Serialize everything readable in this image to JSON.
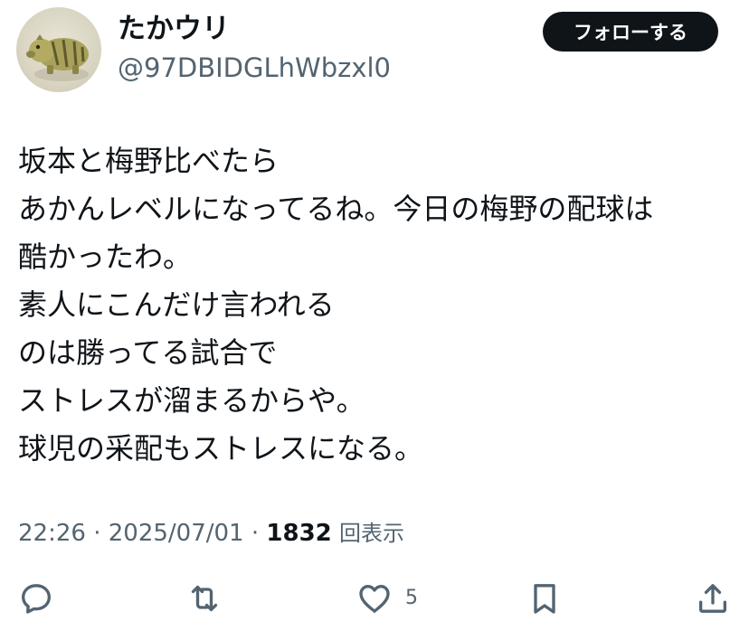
{
  "user": {
    "display_name": "たかウリ",
    "handle": "@97DBIDGLhWbzxl0"
  },
  "follow_button": {
    "label": "フォローする"
  },
  "tweet": {
    "lines": [
      "坂本と梅野比べたら",
      "あかんレベルになってるね。今日の梅野の配球は",
      "酷かったわ。",
      "素人にこんだけ言われる",
      "のは勝ってる試合で",
      "ストレスが溜まるからや。",
      "球児の采配もストレスになる。"
    ]
  },
  "meta": {
    "time": "22:26",
    "separator1": " · ",
    "date": "2025/07/01",
    "separator2": " · ",
    "views_count": "1832",
    "views_label": "回表示"
  },
  "actions": {
    "reply_icon": "reply-icon",
    "retweet_icon": "retweet-icon",
    "like_icon": "heart-icon",
    "like_count": "5",
    "bookmark_icon": "bookmark-icon",
    "share_icon": "share-icon"
  },
  "colors": {
    "text": "#0f1419",
    "secondary": "#536471",
    "button_bg": "#0f1419",
    "button_text": "#ffffff"
  }
}
